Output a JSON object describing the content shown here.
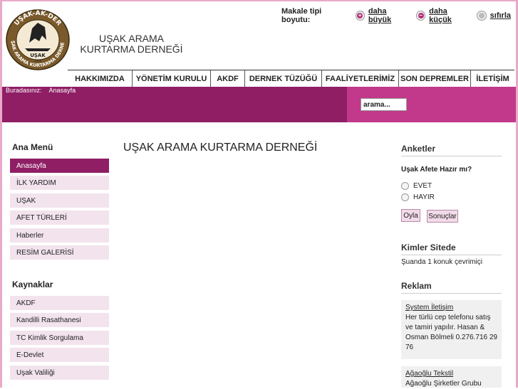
{
  "logo": {
    "text_top": "UŞAK-AK-DER",
    "text_center": "UŞAK",
    "text_year": "2008",
    "text_bottom": "UŞAK ARAMA KURTARMA DERNEĞİ"
  },
  "header": {
    "site_title": "UŞAK ARAMA KURTARMA DERNEĞİ"
  },
  "font_size": {
    "label": "Makale tipi boyutu:",
    "bigger": "daha büyük",
    "smaller": "daha küçük",
    "reset": "sıfırla"
  },
  "nav": {
    "items": [
      {
        "label": "HAKKIMIZDA"
      },
      {
        "label": "YÖNETİM KURULU"
      },
      {
        "label": "AKDF"
      },
      {
        "label": "DERNEK TÜZÜĞÜ"
      },
      {
        "label": "FAALİYETLERİMİZ"
      },
      {
        "label": "SON DEPREMLER"
      },
      {
        "label": "İLETİŞİM"
      }
    ]
  },
  "breadcrumb": {
    "label": "Buradasınız:",
    "current": "Anasayfa"
  },
  "search": {
    "value": "arama..."
  },
  "sidebar": {
    "main_menu_title": "Ana Menü",
    "main_menu": [
      {
        "label": "Anasayfa"
      },
      {
        "label": "İLK YARDIM"
      },
      {
        "label": "UŞAK"
      },
      {
        "label": "AFET TÜRLERİ"
      },
      {
        "label": "Haberler"
      },
      {
        "label": "RESİM GALERİSİ"
      }
    ],
    "resources_title": "Kaynaklar",
    "resources": [
      {
        "label": "AKDF"
      },
      {
        "label": "Kandilli Rasathanesi"
      },
      {
        "label": "TC Kimlik Sorgulama"
      },
      {
        "label": "E-Devlet"
      },
      {
        "label": "Uşak Valiliği"
      }
    ]
  },
  "main": {
    "title": "UŞAK ARAMA KURTARMA DERNEĞİ"
  },
  "right": {
    "poll_title": "Anketler",
    "poll_question": "Uşak Afete Hazır mı?",
    "poll_options": [
      {
        "label": "EVET"
      },
      {
        "label": "HAYIR"
      }
    ],
    "vote_button": "Oyla",
    "results_button": "Sonuçlar",
    "online_title": "Kimler Sitede",
    "online_text": "Şuanda 1 konuk çevrimiçi",
    "ads_title": "Reklam",
    "ads": [
      {
        "title": "System İletişim",
        "text": "Her türlü cep telefonu satış ve tamiri yapılır. Hasan & Osman Bölmeli 0.276.716 29 76"
      },
      {
        "title": "Ağaoğlu Tekstil",
        "text": "Ağaoğlu Şirketler Grubu"
      }
    ]
  },
  "colors": {
    "brand_dark": "#8f1e65",
    "brand_light": "#c2388a",
    "menu_bg": "#f2e3ec"
  }
}
